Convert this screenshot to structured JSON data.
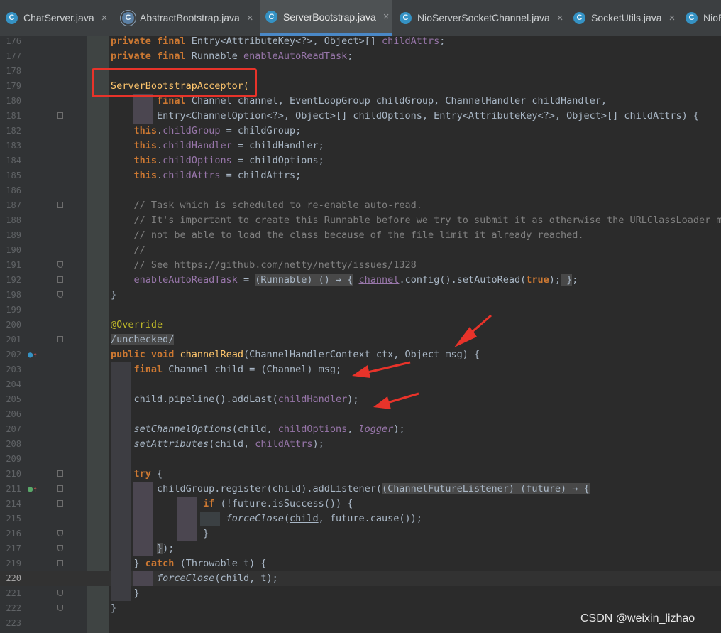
{
  "tabs": [
    {
      "label": "ChatServer.java",
      "icon": "java-class-icon",
      "active": false
    },
    {
      "label": "AbstractBootstrap.java",
      "icon": "abstract-class-icon",
      "active": false
    },
    {
      "label": "ServerBootstrap.java",
      "icon": "java-class-icon",
      "active": true
    },
    {
      "label": "NioServerSocketChannel.java",
      "icon": "java-class-icon",
      "active": false
    },
    {
      "label": "SocketUtils.java",
      "icon": "java-class-icon",
      "active": false
    },
    {
      "label": "NioE",
      "icon": "java-class-icon",
      "active": false
    }
  ],
  "tab_close_glyph": "×",
  "tab_icon_letter": "C",
  "line_numbers": [
    "176",
    "177",
    "178",
    "179",
    "180",
    "181",
    "182",
    "183",
    "184",
    "185",
    "186",
    "187",
    "188",
    "189",
    "190",
    "191",
    "192",
    "198",
    "199",
    "200",
    "201",
    "202",
    "203",
    "204",
    "205",
    "206",
    "207",
    "208",
    "209",
    "210",
    "211",
    "214",
    "215",
    "216",
    "217",
    "219",
    "220",
    "221",
    "222",
    "223"
  ],
  "current_line": "220",
  "highlighted_text": "ServerBootstrapAcceptor(",
  "highlight_color": "#e8332a",
  "comment_url": "https://github.com/netty/netty/issues/1328",
  "watermark": "CSDN @weixin_lizhao",
  "colors": {
    "keyword": "#cc7832",
    "field": "#9876aa",
    "comment": "#808080",
    "annotation": "#bbb529",
    "accent": "#4a88c7"
  }
}
